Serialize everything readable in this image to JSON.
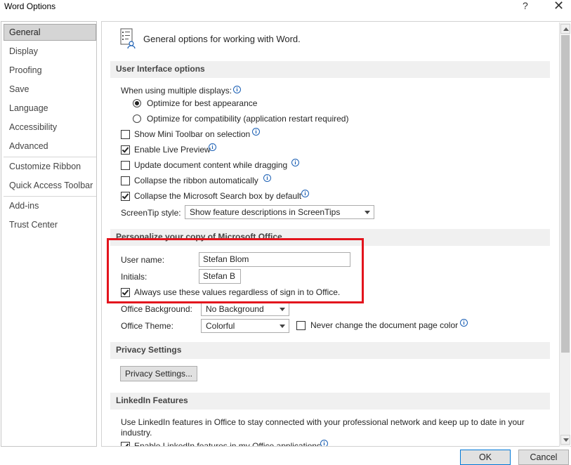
{
  "window": {
    "title": "Word Options",
    "help": "?",
    "close": "✕"
  },
  "nav": {
    "items": [
      "General",
      "Display",
      "Proofing",
      "Save",
      "Language",
      "Accessibility",
      "Advanced",
      "Customize Ribbon",
      "Quick Access Toolbar",
      "Add-ins",
      "Trust Center"
    ],
    "selected": "General"
  },
  "general": {
    "heading": "General options for working with Word.",
    "icon": "options-list-icon"
  },
  "ui_options": {
    "header": "User Interface options",
    "multiple_displays_label": "When using multiple displays:",
    "radio_best": "Optimize for best appearance",
    "radio_compat": "Optimize for compatibility (application restart required)",
    "mini_toolbar": "Show Mini Toolbar on selection",
    "live_preview": "Enable Live Preview",
    "update_dragging": "Update document content while dragging",
    "collapse_ribbon": "Collapse the ribbon automatically",
    "collapse_search": "Collapse the Microsoft Search box by default",
    "screentip_label": "ScreenTip style:",
    "screentip_value": "Show feature descriptions in ScreenTips"
  },
  "personalize": {
    "header": "Personalize your copy of Microsoft Office",
    "username_label": "User name:",
    "username_value": "Stefan Blom",
    "initials_label": "Initials:",
    "initials_value": "Stefan B",
    "always_use": "Always use these values regardless of sign in to Office.",
    "background_label": "Office Background:",
    "background_value": "No Background",
    "theme_label": "Office Theme:",
    "theme_value": "Colorful",
    "never_change": "Never change the document page color"
  },
  "privacy": {
    "header": "Privacy Settings",
    "button": "Privacy Settings..."
  },
  "linkedin": {
    "header": "LinkedIn Features",
    "text": "Use LinkedIn features in Office to stay connected with your professional network and keep up to date in your industry.",
    "enable": "Enable LinkedIn features in my Office applications"
  },
  "footer": {
    "ok": "OK",
    "cancel": "Cancel"
  },
  "state": {
    "radio_best_selected": true,
    "mini_toolbar": false,
    "live_preview": true,
    "update_dragging": false,
    "collapse_ribbon": false,
    "collapse_search": true,
    "always_use": true,
    "never_change": false,
    "linkedin_enable": true
  },
  "colors": {
    "highlight_box": "#e3141d",
    "info_icon": "#1a5fb4",
    "nav_selected": "#d5d5d5"
  }
}
